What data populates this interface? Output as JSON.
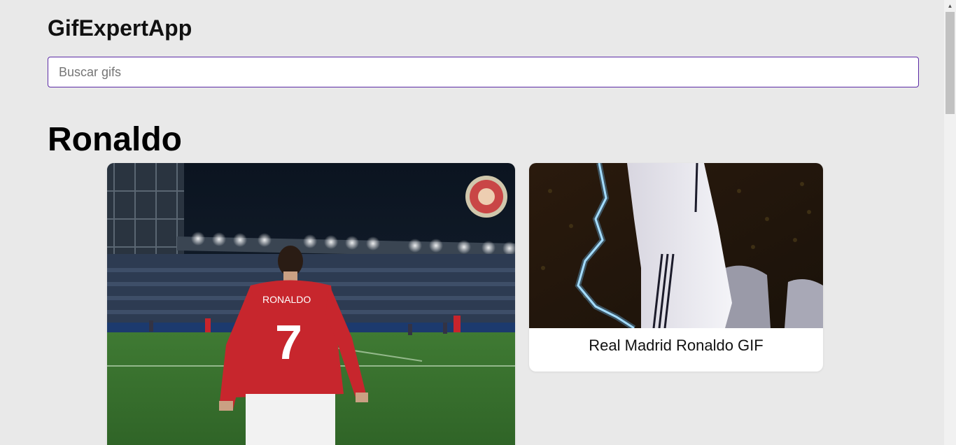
{
  "app": {
    "title": "GifExpertApp"
  },
  "search": {
    "placeholder": "Buscar gifs",
    "value": ""
  },
  "categories": [
    {
      "title": "Ronaldo",
      "gifs": [
        {
          "title": "",
          "image": "ronaldo-manchester-united-celebration"
        },
        {
          "title": "Real Madrid Ronaldo GIF",
          "image": "ronaldo-real-madrid-lightning"
        }
      ]
    }
  ],
  "colors": {
    "background": "#e9e9e9",
    "input_border": "#5b2aa5",
    "card_background": "#ffffff"
  }
}
